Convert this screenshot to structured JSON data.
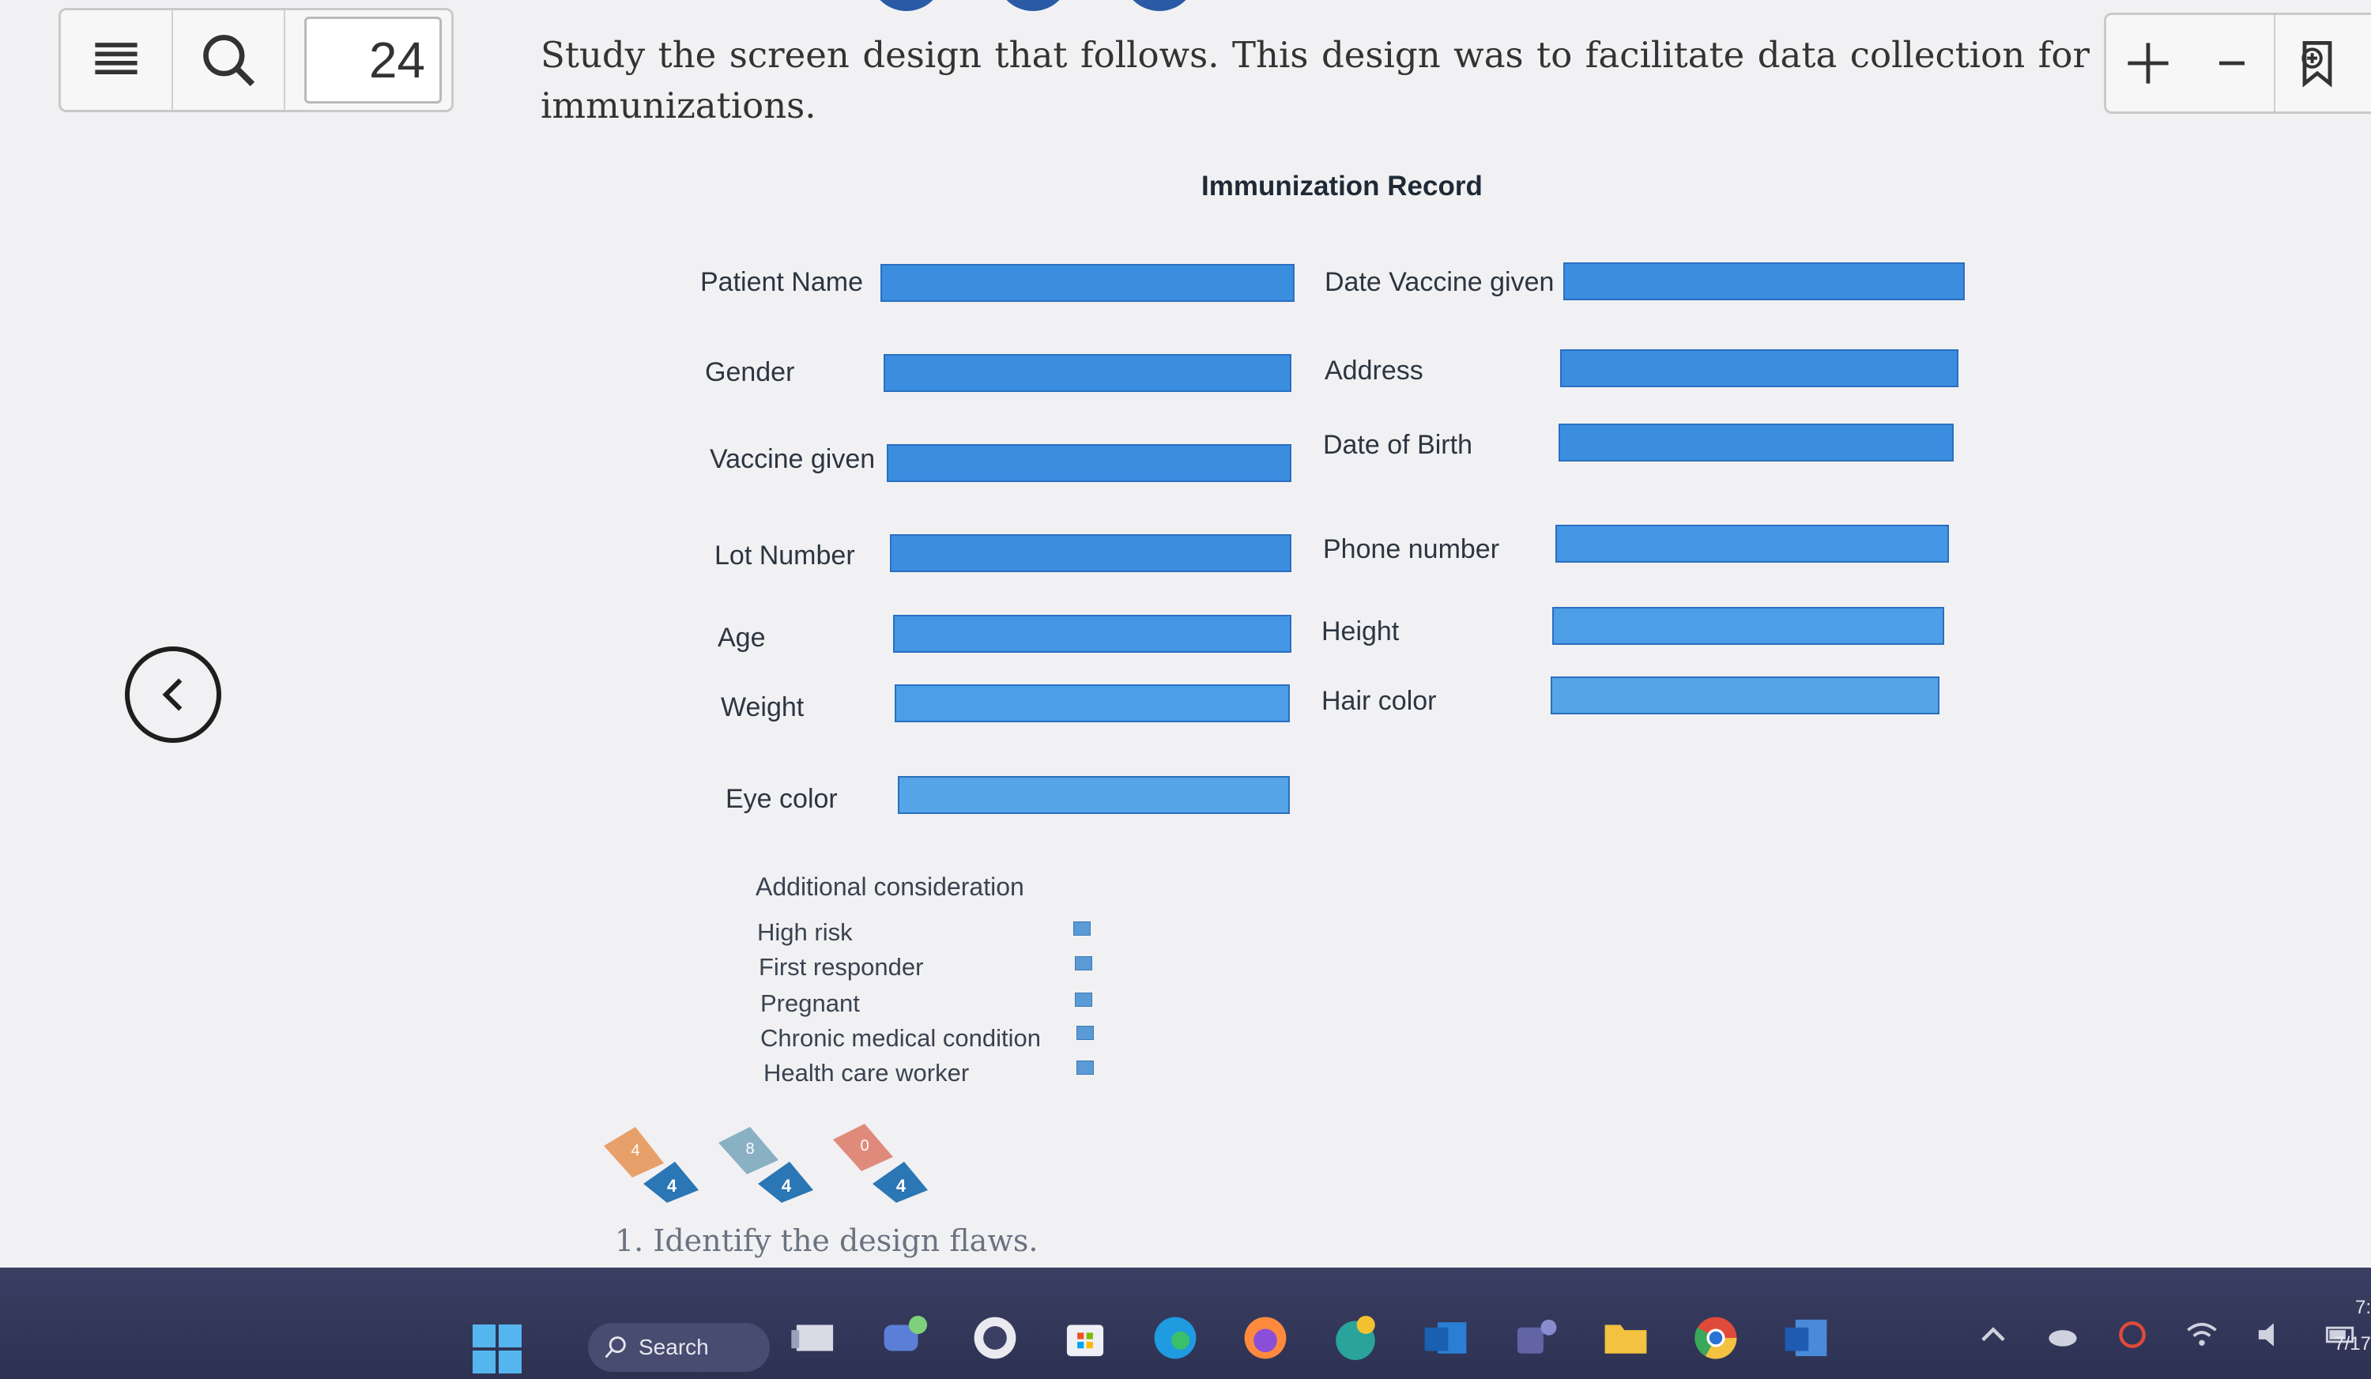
{
  "toolbar": {
    "menu_icon": "hamburger-menu-icon",
    "search_icon": "search-icon",
    "page_number": "24",
    "zoom_in_label": "+",
    "zoom_out_label": "−",
    "bookmark_icon": "bookmark-add-icon"
  },
  "intro": {
    "text": "Study the screen design that follows. This design was to facilitate data collection for immunizations."
  },
  "form": {
    "title": "Immunization Record",
    "left_fields": [
      {
        "label": "Patient Name"
      },
      {
        "label": "Gender"
      },
      {
        "label": "Vaccine given"
      },
      {
        "label": "Lot Number"
      },
      {
        "label": "Age"
      },
      {
        "label": "Weight"
      },
      {
        "label": "Eye color"
      }
    ],
    "right_fields": [
      {
        "label": "Date Vaccine given"
      },
      {
        "label": "Address"
      },
      {
        "label": "Date of Birth"
      },
      {
        "label": "Phone number"
      },
      {
        "label": "Height"
      },
      {
        "label": "Hair color"
      }
    ],
    "additional_title": "Additional consideration",
    "options": [
      {
        "label": "High risk"
      },
      {
        "label": "First responder"
      },
      {
        "label": "Pregnant"
      },
      {
        "label": "Chronic medical condition"
      },
      {
        "label": "Health care worker"
      }
    ],
    "field_color": "#3b8de0"
  },
  "badges": [
    {
      "top_label": "4",
      "bottom_label": "4",
      "top_color": "#e8a06a"
    },
    {
      "top_label": "8",
      "bottom_label": "4",
      "top_color": "#8ab0c4"
    },
    {
      "top_label": "0",
      "bottom_label": "4",
      "top_color": "#e08a7c"
    }
  ],
  "question": {
    "text": "1.  Identify the design flaws."
  },
  "taskbar": {
    "search_label": "Search",
    "clock_time": "7:",
    "clock_date": "7/17"
  }
}
